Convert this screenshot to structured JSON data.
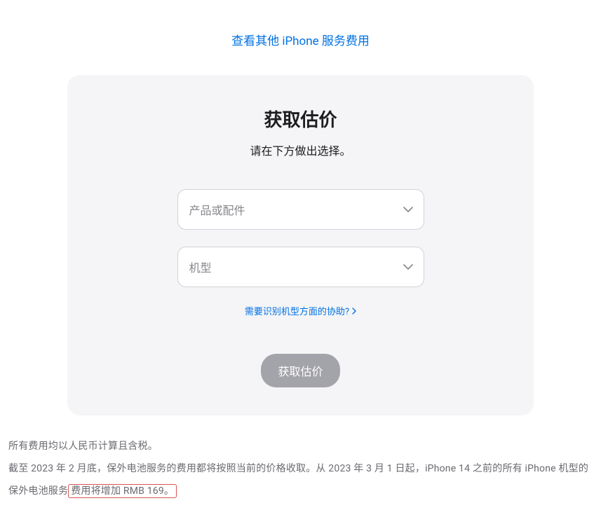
{
  "topLink": {
    "label": "查看其他 iPhone 服务费用"
  },
  "card": {
    "title": "获取估价",
    "subtitle": "请在下方做出选择。",
    "selectProduct": {
      "placeholder": "产品或配件"
    },
    "selectModel": {
      "placeholder": "机型"
    },
    "helpLink": {
      "label": "需要识别机型方面的协助?"
    },
    "submitButton": {
      "label": "获取估价"
    }
  },
  "footer": {
    "line1": "所有费用均以人民币计算且含税。",
    "line2_prefix": "截至 2023 年 2 月底，保外电池服务的费用都将按照当前的价格收取。从 2023 年 3 月 1 日起，iPhone 14 之前的所有 iPhone 机型的保外电池服务",
    "line2_highlight": "费用将增加 RMB 169。"
  }
}
